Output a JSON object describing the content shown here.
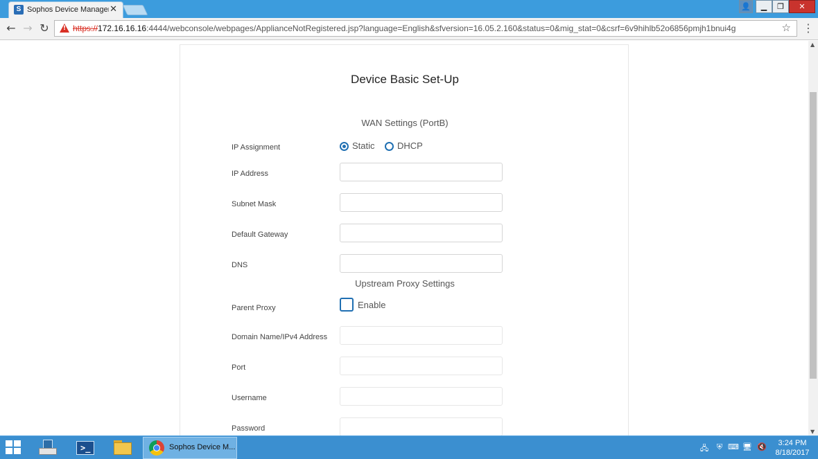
{
  "browser": {
    "tab_title": "Sophos Device Managem",
    "tab_favicon": "S",
    "url_scheme": "https://",
    "url_host": "172.16.16.16",
    "url_rest": ":4444/webconsole/webpages/ApplianceNotRegistered.jsp?language=English&sfversion=16.05.2.160&status=0&mig_stat=0&csrf=6v9hihlb52o6856pmjh1bnui4g"
  },
  "form": {
    "title": "Device Basic Set-Up",
    "wan_header": "WAN Settings (PortB)",
    "ip_assignment_label": "IP Assignment",
    "ip_assignment_options": [
      "Static",
      "DHCP"
    ],
    "ip_assignment_selected": "Static",
    "ip_address_label": "IP Address",
    "ip_address_value": "",
    "subnet_mask_label": "Subnet Mask",
    "subnet_mask_value": "",
    "default_gateway_label": "Default Gateway",
    "default_gateway_value": "",
    "dns_label": "DNS",
    "dns_value": "",
    "proxy_header": "Upstream Proxy Settings",
    "parent_proxy_label": "Parent Proxy",
    "parent_proxy_checkbox_label": "Enable",
    "parent_proxy_enabled": false,
    "domain_label": "Domain Name/IPv4 Address",
    "domain_value": "",
    "port_label": "Port",
    "port_value": "",
    "username_label": "Username",
    "username_value": "",
    "password_label": "Password",
    "password_value": ""
  },
  "taskbar": {
    "chrome_label": "Sophos Device M...",
    "time": "3:24 PM",
    "date": "8/18/2017"
  },
  "colors": {
    "accent": "#1f6fb2",
    "titlebar": "#3c9cdd",
    "taskbar": "#3b8fd0"
  }
}
